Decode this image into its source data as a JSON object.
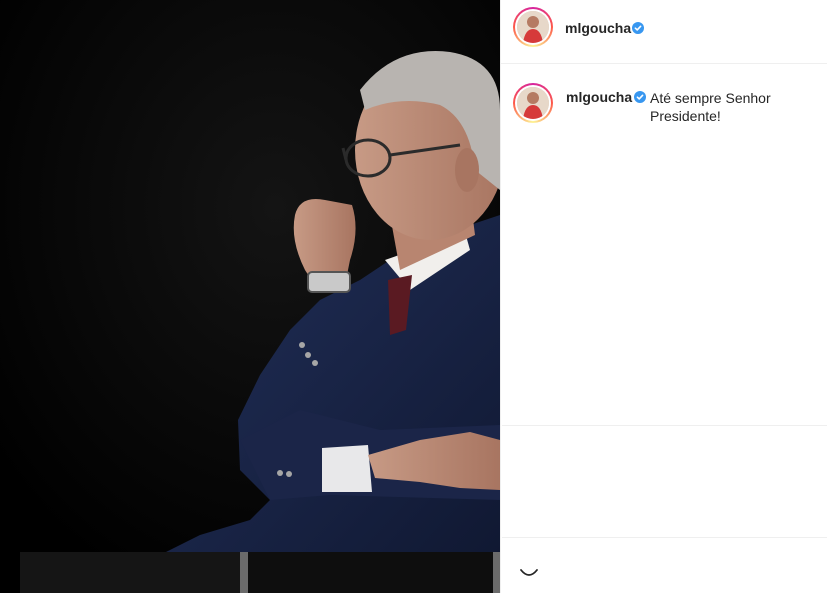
{
  "post": {
    "username": "mlgoucha",
    "verified": true,
    "caption": "Até sempre Senhor Presidente!"
  },
  "icons": {
    "verified": "verified-badge-icon",
    "comment": "smiley-emoji-icon"
  },
  "colors": {
    "verified_blue": "#3897f0",
    "text": "#262626",
    "divider": "#efefef"
  }
}
